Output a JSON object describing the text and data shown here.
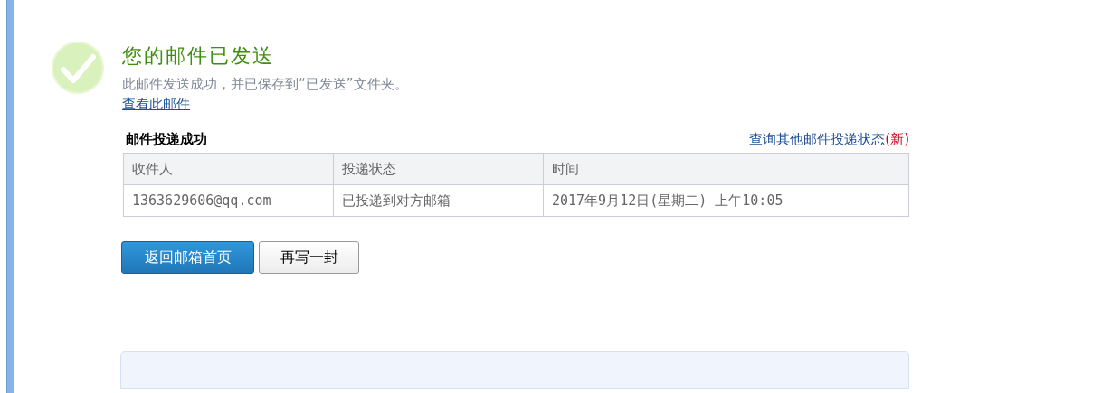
{
  "title": "您的邮件已发送",
  "message": "此邮件发送成功，并已保存到“已发送”文件夹。",
  "view_link": "查看此邮件",
  "delivery": {
    "heading": "邮件投递成功",
    "query_link": "查询其他邮件投递状态",
    "new_badge": "(新)",
    "columns": [
      "收件人",
      "投递状态",
      "时间"
    ],
    "rows": [
      [
        "1363629606@qq.com",
        "已投递到对方邮箱",
        "2017年9月12日(星期二) 上午10:05"
      ]
    ]
  },
  "buttons": [
    {
      "label": "返回邮箱首页",
      "kind": "primary"
    },
    {
      "label": "再写一封",
      "kind": "secondary"
    }
  ]
}
